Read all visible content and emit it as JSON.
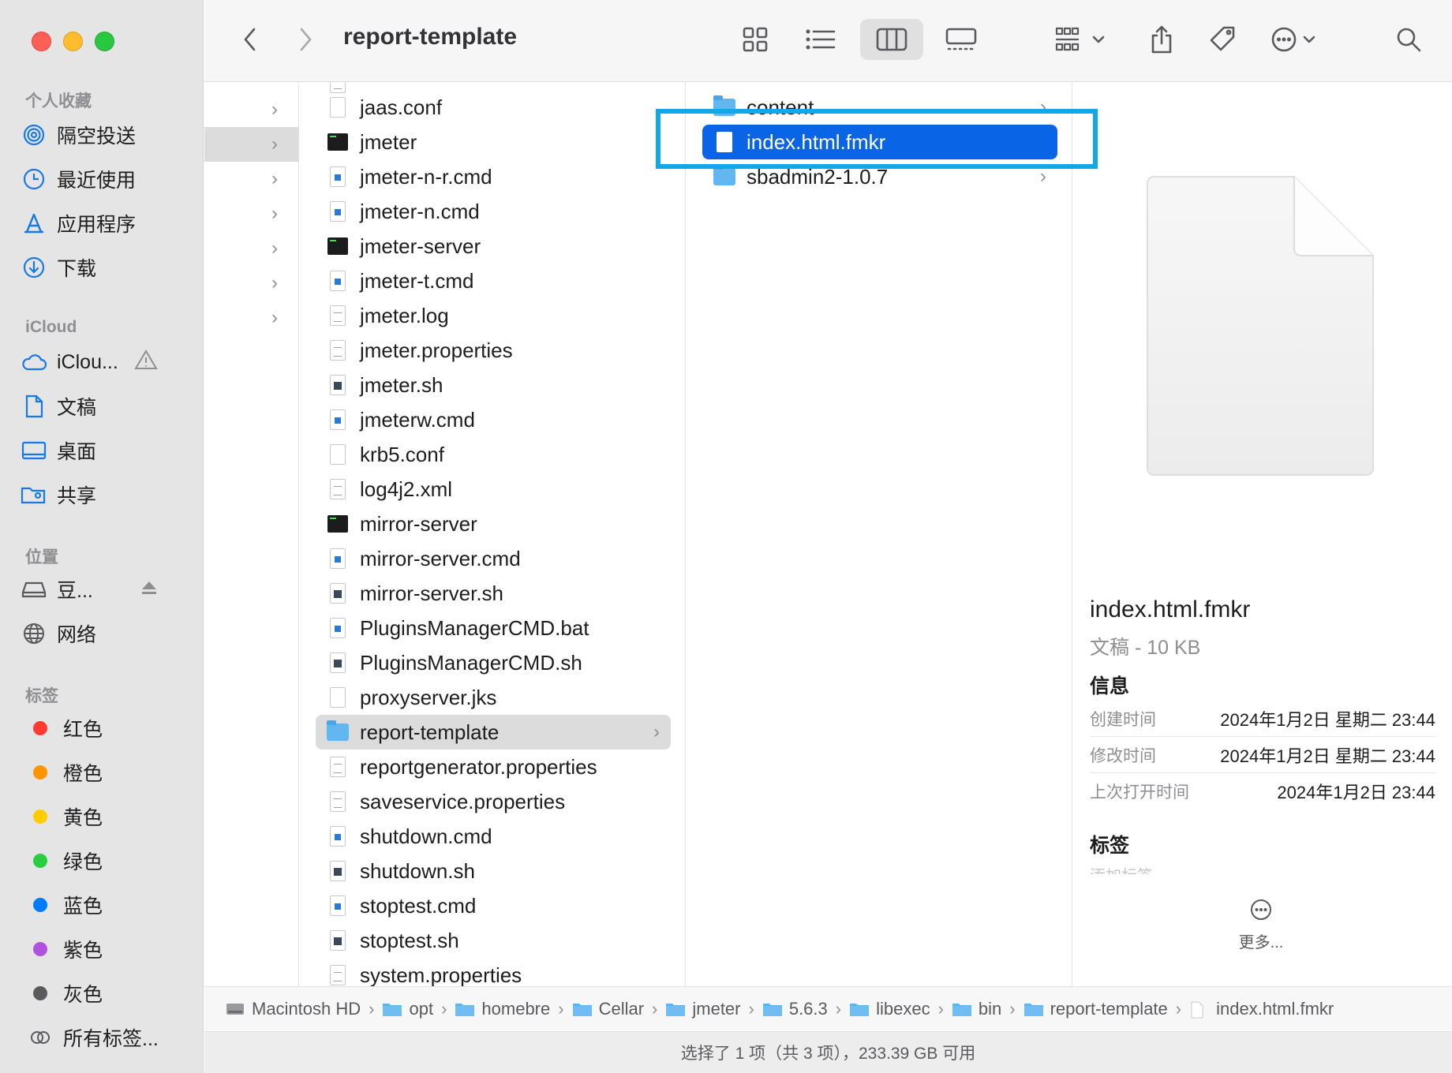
{
  "sidebar": {
    "favorites_title": "个人收藏",
    "favorites": [
      {
        "label": "隔空投送",
        "icon": "airdrop-icon"
      },
      {
        "label": "最近使用",
        "icon": "clock-icon"
      },
      {
        "label": "应用程序",
        "icon": "applications-icon"
      },
      {
        "label": "下载",
        "icon": "download-icon"
      }
    ],
    "icloud_title": "iCloud",
    "icloud": [
      {
        "label": "iClou...",
        "icon": "cloud-icon"
      },
      {
        "label": "文稿",
        "icon": "document-icon"
      },
      {
        "label": "桌面",
        "icon": "desktop-icon"
      },
      {
        "label": "共享",
        "icon": "shared-folder-icon"
      }
    ],
    "locations_title": "位置",
    "locations": [
      {
        "label": "豆...",
        "icon": "drive-icon"
      },
      {
        "label": "网络",
        "icon": "globe-icon"
      }
    ],
    "tags_title": "标签",
    "tags": [
      {
        "label": "红色",
        "color": "#ff3b30"
      },
      {
        "label": "橙色",
        "color": "#ff9500"
      },
      {
        "label": "黄色",
        "color": "#ffcc00"
      },
      {
        "label": "绿色",
        "color": "#28cd41"
      },
      {
        "label": "蓝色",
        "color": "#007aff"
      },
      {
        "label": "紫色",
        "color": "#af52de"
      },
      {
        "label": "灰色",
        "color": "#5a5a5e"
      }
    ],
    "all_tags": "所有标签..."
  },
  "toolbar": {
    "title": "report-template"
  },
  "column2": {
    "items": [
      {
        "name": "jaas.conf",
        "icon": "blank"
      },
      {
        "name": "jmeter",
        "icon": "terminal"
      },
      {
        "name": "jmeter-n-r.cmd",
        "icon": "win"
      },
      {
        "name": "jmeter-n.cmd",
        "icon": "win"
      },
      {
        "name": "jmeter-server",
        "icon": "terminal"
      },
      {
        "name": "jmeter-t.cmd",
        "icon": "win"
      },
      {
        "name": "jmeter.log",
        "icon": "lines"
      },
      {
        "name": "jmeter.properties",
        "icon": "lines"
      },
      {
        "name": "jmeter.sh",
        "icon": "sh"
      },
      {
        "name": "jmeterw.cmd",
        "icon": "win"
      },
      {
        "name": "krb5.conf",
        "icon": "blank"
      },
      {
        "name": "log4j2.xml",
        "icon": "lines"
      },
      {
        "name": "mirror-server",
        "icon": "terminal"
      },
      {
        "name": "mirror-server.cmd",
        "icon": "win"
      },
      {
        "name": "mirror-server.sh",
        "icon": "sh"
      },
      {
        "name": "PluginsManagerCMD.bat",
        "icon": "win"
      },
      {
        "name": "PluginsManagerCMD.sh",
        "icon": "sh"
      },
      {
        "name": "proxyserver.jks",
        "icon": "blank"
      },
      {
        "name": "report-template",
        "icon": "folder"
      },
      {
        "name": "reportgenerator.properties",
        "icon": "lines"
      },
      {
        "name": "saveservice.properties",
        "icon": "lines"
      },
      {
        "name": "shutdown.cmd",
        "icon": "win"
      },
      {
        "name": "shutdown.sh",
        "icon": "sh"
      },
      {
        "name": "stoptest.cmd",
        "icon": "win"
      },
      {
        "name": "stoptest.sh",
        "icon": "sh"
      },
      {
        "name": "system.properties",
        "icon": "lines"
      }
    ]
  },
  "column3": {
    "items": [
      {
        "name": "content",
        "icon": "folder"
      },
      {
        "name": "index.html.fmkr",
        "icon": "doc"
      },
      {
        "name": "sbadmin2-1.0.7",
        "icon": "folder"
      }
    ]
  },
  "preview": {
    "name": "index.html.fmkr",
    "kind_size": "文稿 - 10 KB",
    "info_title": "信息",
    "rows": [
      {
        "key": "创建时间",
        "value": "2024年1月2日 星期二 23:44"
      },
      {
        "key": "修改时间",
        "value": "2024年1月2日 星期二 23:44"
      },
      {
        "key": "上次打开时间",
        "value": "2024年1月2日 23:44"
      }
    ],
    "tags_title": "标签",
    "add_tags": "添加标签",
    "more_label": "更多..."
  },
  "pathbar": [
    {
      "label": "Macintosh HD",
      "icon": "hd"
    },
    {
      "label": "opt",
      "icon": "folder"
    },
    {
      "label": "homebre",
      "icon": "folder"
    },
    {
      "label": "Cellar",
      "icon": "folder"
    },
    {
      "label": "jmeter",
      "icon": "folder"
    },
    {
      "label": "5.6.3",
      "icon": "folder"
    },
    {
      "label": "libexec",
      "icon": "folder"
    },
    {
      "label": "bin",
      "icon": "folder"
    },
    {
      "label": "report-template",
      "icon": "folder"
    },
    {
      "label": "index.html.fmkr",
      "icon": "doc"
    }
  ],
  "status": "选择了 1 项（共 3 项），233.39 GB 可用"
}
